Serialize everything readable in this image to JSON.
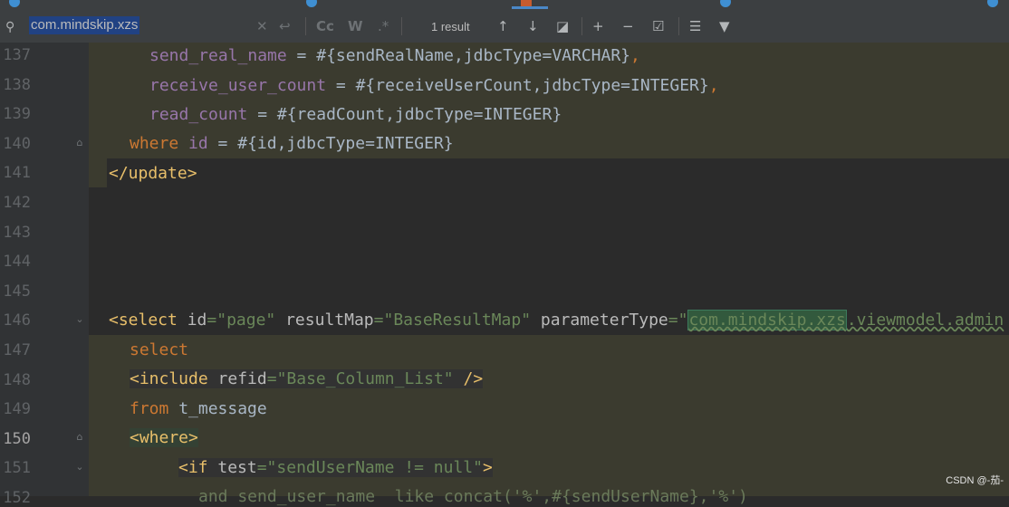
{
  "find": {
    "query": "com.mindskip.xzs",
    "result": "1 result"
  },
  "lines": [
    {
      "n": "137",
      "code": "send_real_name = #{sendRealName,jdbcType=VARCHAR},"
    },
    {
      "n": "138",
      "code": "receive_user_count = #{receiveUserCount,jdbcType=INTEGER},"
    },
    {
      "n": "139",
      "code": "read_count = #{readCount,jdbcType=INTEGER}"
    },
    {
      "n": "140",
      "code": "where id = #{id,jdbcType=INTEGER}"
    },
    {
      "n": "141",
      "code": "</update>"
    },
    {
      "n": "142",
      "code": ""
    },
    {
      "n": "143",
      "code": ""
    },
    {
      "n": "144",
      "code": ""
    },
    {
      "n": "145",
      "code": ""
    },
    {
      "n": "146",
      "code": "<select id=\"page\" resultMap=\"BaseResultMap\" parameterType=\"com.mindskip.xzs.viewmodel.admin"
    },
    {
      "n": "147",
      "code": "select"
    },
    {
      "n": "148",
      "code": "<include refid=\"Base_Column_List\" />"
    },
    {
      "n": "149",
      "code": "from t_message"
    },
    {
      "n": "150",
      "code": "<where>"
    },
    {
      "n": "151",
      "code": "<if test=\"sendUserName != null\">"
    },
    {
      "n": "152",
      "code": ""
    }
  ],
  "watermark": "CSDN @-茄-"
}
